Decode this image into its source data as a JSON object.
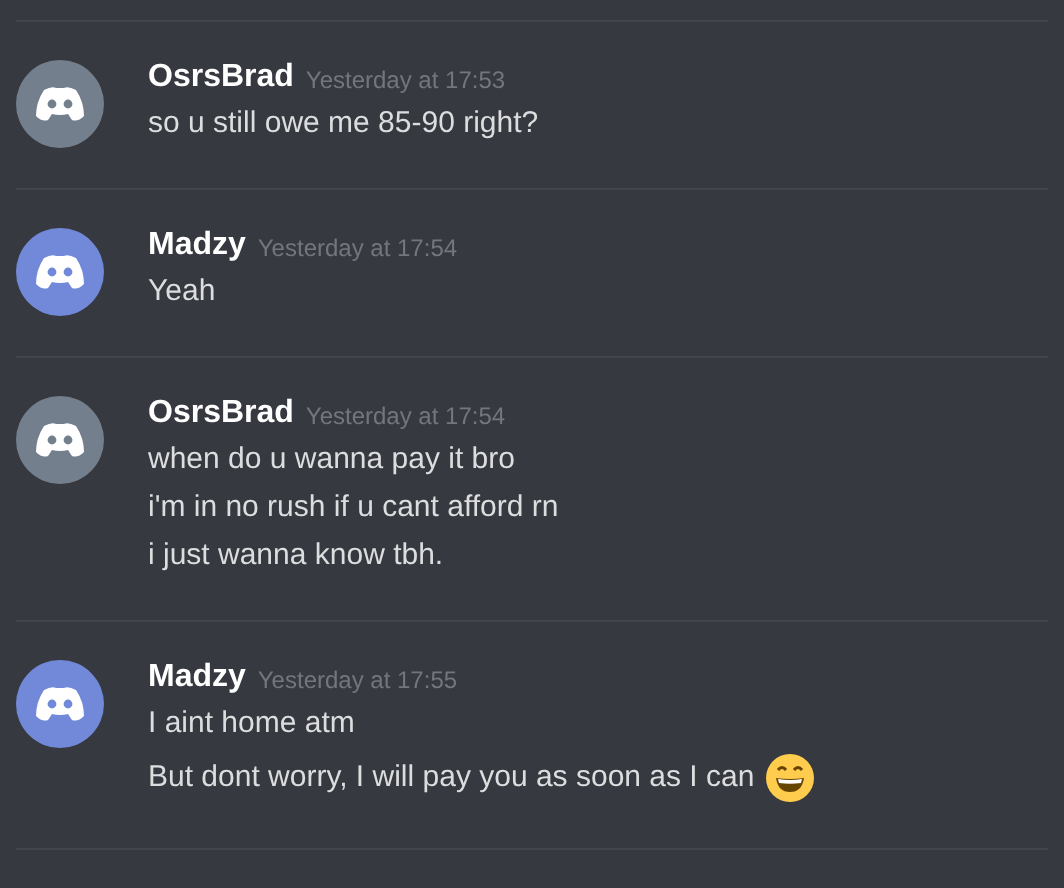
{
  "messages": [
    {
      "author": "OsrsBrad",
      "time": "Yesterday at 17:53",
      "color": "#747f8d",
      "lines": [
        {
          "text": "so u still owe me 85-90 right?",
          "emoji": false
        }
      ]
    },
    {
      "author": "Madzy",
      "time": "Yesterday at 17:54",
      "color": "#7289da",
      "lines": [
        {
          "text": "Yeah",
          "emoji": false
        }
      ]
    },
    {
      "author": "OsrsBrad",
      "time": "Yesterday at 17:54",
      "color": "#747f8d",
      "lines": [
        {
          "text": "when do u wanna pay it bro",
          "emoji": false
        },
        {
          "text": "i'm in no rush if u cant afford rn",
          "emoji": false
        },
        {
          "text": "i just wanna know tbh.",
          "emoji": false
        }
      ]
    },
    {
      "author": "Madzy",
      "time": "Yesterday at 17:55",
      "color": "#7289da",
      "lines": [
        {
          "text": "I aint home atm",
          "emoji": false
        },
        {
          "text": "But dont worry, I will pay you as soon as I can",
          "emoji": true
        }
      ]
    }
  ]
}
